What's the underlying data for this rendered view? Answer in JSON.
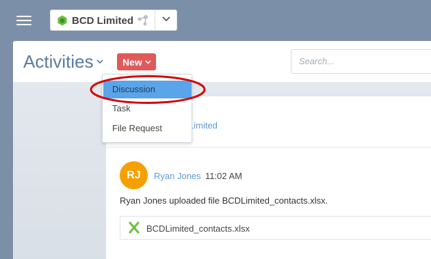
{
  "topbar": {
    "menu_icon": "hamburger-icon",
    "company": {
      "name": "BCD Limited",
      "logo_icon": "green-hexagon-icon",
      "network_icon": "network-nodes-icon",
      "dropdown_icon": "chevron-down-icon"
    }
  },
  "page": {
    "title": "Activities",
    "new_button": "New",
    "search": {
      "placeholder": "Search..."
    }
  },
  "new_menu": {
    "items": [
      {
        "label": "Discussion",
        "highlighted": true
      },
      {
        "label": "Task"
      },
      {
        "label": "File Request"
      }
    ]
  },
  "card": {
    "header_link": "Limited",
    "post": {
      "avatar_initials": "RJ",
      "author": "Ryan Jones",
      "time": "11:02 AM",
      "message": "Ryan Jones uploaded file BCDLimited_contacts.xlsx.",
      "attachment": {
        "file_name": "BCDLimited_contacts.xlsx",
        "icon": "excel-file-icon"
      }
    }
  },
  "colors": {
    "topbar_bg": "#7b8fa8",
    "title": "#5a7a9c",
    "new_button": "#e05a5a",
    "menu_highlight": "#5aa4ea",
    "link": "#5b9bd5",
    "avatar": "#f5a000",
    "annotation": "#d60000"
  }
}
